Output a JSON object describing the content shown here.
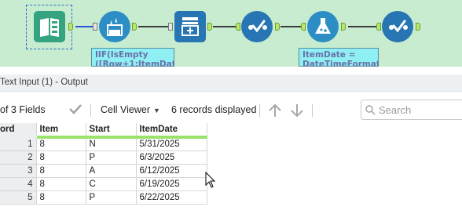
{
  "canvas": {
    "annotation_formula": "IIF(IsEmpty\n([Row+1:ItemDat",
    "annotation_itemdate": "ItemDate =\nDateTimeFormat",
    "colors": {
      "background": "#c8ecd0",
      "input_tool": "#34a37f",
      "formula_tool": "#2c8ec4",
      "select_tool": "#2775b3",
      "annotation": "#8ff0f4"
    }
  },
  "results": {
    "title": "Text Input (1) - Output",
    "toolbar": {
      "fields_label": "of 3 Fields",
      "cell_viewer_label": "Cell Viewer",
      "records_label": "6 records displayed",
      "search_placeholder": "Search"
    },
    "grid": {
      "columns": [
        "ord",
        "Item",
        "Start",
        "ItemDate"
      ],
      "rows": [
        {
          "record": "1",
          "item": "8",
          "start": "N",
          "item_date": "5/31/2025"
        },
        {
          "record": "2",
          "item": "8",
          "start": "P",
          "item_date": "6/3/2025"
        },
        {
          "record": "3",
          "item": "8",
          "start": "A",
          "item_date": "6/12/2025"
        },
        {
          "record": "4",
          "item": "8",
          "start": "C",
          "item_date": "6/19/2025"
        },
        {
          "record": "5",
          "item": "8",
          "start": "P",
          "item_date": "6/22/2025"
        }
      ]
    }
  }
}
